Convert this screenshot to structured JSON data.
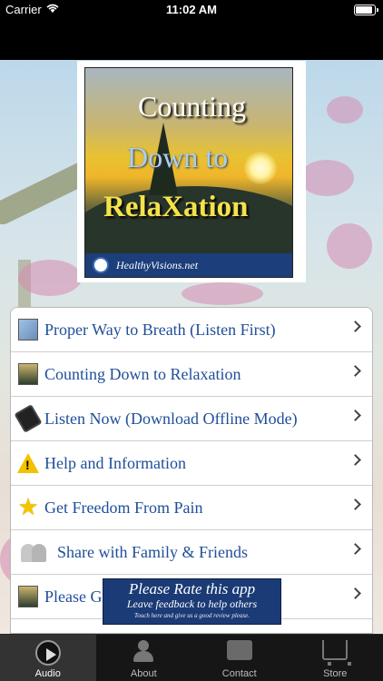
{
  "status_bar": {
    "carrier": "Carrier",
    "time": "11:02 AM"
  },
  "album": {
    "title_line1": "Counting",
    "title_line2": "Down to",
    "title_line3": "RelaXation",
    "footer": "HealthyVisions.net"
  },
  "menu": {
    "items": [
      {
        "label": "Proper Way to Breath (Listen First)",
        "icon": "breathing-thumbnail-icon"
      },
      {
        "label": "Counting Down to Relaxation",
        "icon": "album-thumbnail-icon"
      },
      {
        "label": "Listen Now (Download Offline Mode)",
        "icon": "phone-icon"
      },
      {
        "label": "Help and Information",
        "icon": "warning-icon"
      },
      {
        "label": "Get Freedom From Pain",
        "icon": "star-icon"
      },
      {
        "label": "Share with Family & Friends",
        "icon": "people-icon"
      },
      {
        "label": "Please G",
        "icon": "album-thumbnail-icon"
      }
    ]
  },
  "rate_banner": {
    "title": "Please Rate this app",
    "subtitle": "Leave feedback to help others",
    "fine_print": "Touch here and give us a good review please."
  },
  "tabs": [
    {
      "label": "Audio",
      "icon": "play-icon",
      "active": true
    },
    {
      "label": "About",
      "icon": "profile-icon",
      "active": false
    },
    {
      "label": "Contact",
      "icon": "contact-card-icon",
      "active": false
    },
    {
      "label": "Store",
      "icon": "cart-icon",
      "active": false
    }
  ],
  "colors": {
    "menu_text": "#1f4e98",
    "banner_bg": "#1b3b76",
    "tabbar_bg": "#161616"
  }
}
